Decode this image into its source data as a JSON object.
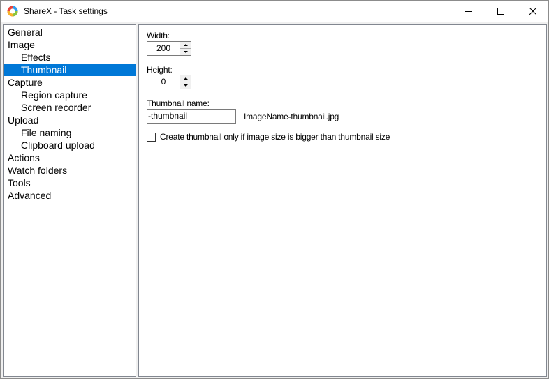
{
  "window": {
    "title": "ShareX - Task settings"
  },
  "nav": {
    "items": [
      {
        "label": "General",
        "level": 0,
        "selected": false
      },
      {
        "label": "Image",
        "level": 0,
        "selected": false
      },
      {
        "label": "Effects",
        "level": 1,
        "selected": false
      },
      {
        "label": "Thumbnail",
        "level": 1,
        "selected": true
      },
      {
        "label": "Capture",
        "level": 0,
        "selected": false
      },
      {
        "label": "Region capture",
        "level": 1,
        "selected": false
      },
      {
        "label": "Screen recorder",
        "level": 1,
        "selected": false
      },
      {
        "label": "Upload",
        "level": 0,
        "selected": false
      },
      {
        "label": "File naming",
        "level": 1,
        "selected": false
      },
      {
        "label": "Clipboard upload",
        "level": 1,
        "selected": false
      },
      {
        "label": "Actions",
        "level": 0,
        "selected": false
      },
      {
        "label": "Watch folders",
        "level": 0,
        "selected": false
      },
      {
        "label": "Tools",
        "level": 0,
        "selected": false
      },
      {
        "label": "Advanced",
        "level": 0,
        "selected": false
      }
    ]
  },
  "thumbnail": {
    "width_label": "Width:",
    "width_value": "200",
    "height_label": "Height:",
    "height_value": "0",
    "name_label": "Thumbnail name:",
    "name_value": "-thumbnail",
    "name_preview": "ImageName-thumbnail.jpg",
    "only_bigger_label": "Create thumbnail only if image size is bigger than thumbnail size",
    "only_bigger_checked": false
  },
  "colors": {
    "selection": "#0078d7",
    "border": "#828790",
    "window_bg": "#f0f0f0"
  }
}
